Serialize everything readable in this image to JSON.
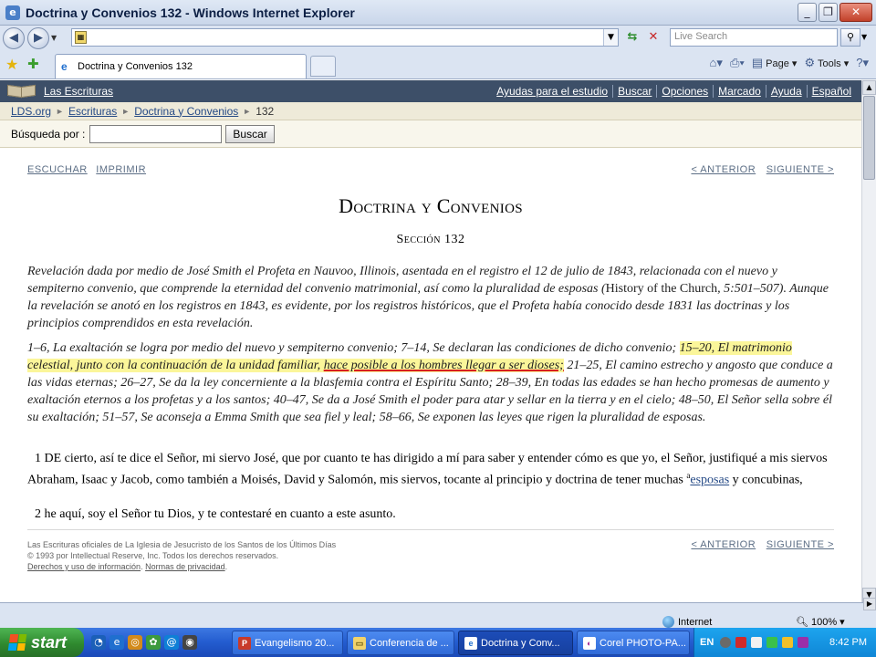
{
  "window": {
    "title": "Doctrina y Convenios 132 - Windows Internet Explorer",
    "minimize": "_",
    "restore": "❐",
    "close": "✕"
  },
  "browser": {
    "address_value": "",
    "search_placeholder": "Live Search",
    "tab_label": "Doctrina y Convenios 132",
    "page_menu": "Page",
    "tools_menu": "Tools"
  },
  "site": {
    "name": "Las Escrituras",
    "links": [
      "Ayudas para el estudio",
      "Buscar",
      "Opciones",
      "Marcado",
      "Ayuda",
      "Español"
    ]
  },
  "breadcrumb": [
    "LDS.org",
    "Escrituras",
    "Doctrina y Convenios",
    "132"
  ],
  "search": {
    "label": "Búsqueda por :",
    "value": "",
    "button": "Buscar"
  },
  "page": {
    "listen": "ESCUCHAR",
    "print": "IMPRIMIR",
    "prev": "< ANTERIOR",
    "next": "SIGUIENTE >",
    "book_title": "Doctrina y Convenios",
    "section_title": "Sección 132",
    "intro_before": "Revelación dada por medio de José Smith el Profeta en Nauvoo, Illinois, asentada en el registro el 12 de julio de 1843, relacionada con el nuevo y sempiterno convenio, que comprende la eternidad del convenio matrimonial, así como la pluralidad de esposas (",
    "intro_source": "History of the Church",
    "intro_after": ", 5:501–507). Aunque la revelación se anotó en los registros en 1843, es evidente, por los registros históricos, que el Profeta había conocido desde 1831 las doctrinas y los principios comprendidos en esta revelación.",
    "summary_a": "1–6, La exaltación se logra por medio del nuevo y sempiterno convenio; 7–14, Se declaran las condiciones de dicho convenio; ",
    "summary_hl1": "15–20, El matrimonio celestial, junto con la continuación de la unidad familiar, ",
    "summary_hl2": "hace posible a los hombres llegar a ser dioses;",
    "summary_b": " 21–25, El camino estrecho y angosto que conduce a las vidas eternas; 26–27, Se da la ley concerniente a la blasfemia contra el Espíritu Santo; 28–39, En todas las edades se han hecho promesas de aumento y exaltación eternos a los profetas y a los santos; 40–47, Se da a José Smith el poder para atar y sellar en la tierra y en el cielo; 48–50, El Señor sella sobre él su exaltación; 51–57, Se aconseja a Emma Smith que sea fiel y leal; 58–66, Se exponen las leyes que rigen la pluralidad de esposas.",
    "verse1_text": "1 DE cierto, así te dice el Señor, mi siervo José, que por cuanto te has dirigido a mí para saber y entender cómo es que yo, el Señor, justifiqué a mis siervos Abraham, Isaac y Jacob, como también a Moisés, David y Salomón, mis siervos, tocante al principio y doctrina de tener muchas ",
    "verse1_sup": "a",
    "verse1_link": "esposas",
    "verse1_end": " y concubinas,",
    "verse2_text": "2 he aquí, soy el Señor tu Dios, y te contestaré en cuanto a este asunto.",
    "footer_line1": "Las Escrituras oficiales de La Iglesia de Jesucristo de los Santos de los Últimos Días",
    "footer_line2": "© 1993 por Intellectual Reserve, Inc. Todos los derechos reservados.",
    "footer_terms": "Derechos y uso de información",
    "footer_privacy": "Normas de privacidad"
  },
  "status": {
    "zone": "Internet",
    "zoom": "100%"
  },
  "taskbar": {
    "start": "start",
    "tasks": [
      "Evangelismo 20...",
      "Conferencia de ...",
      "Doctrina y Conv...",
      "Corel PHOTO-PA..."
    ],
    "lang": "EN",
    "clock": "8:42 PM"
  },
  "colors": {
    "site_header": "#3d4f68",
    "highlight": "#fbf69a",
    "underline_red": "#d81f1f",
    "link": "#254a86"
  }
}
